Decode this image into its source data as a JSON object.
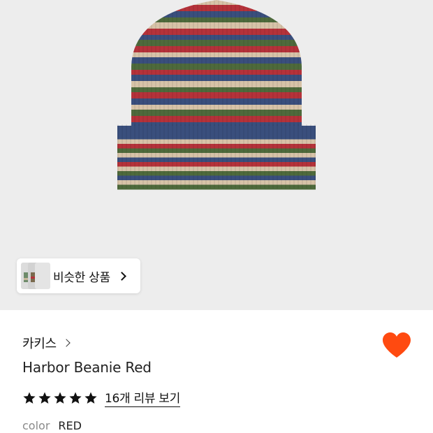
{
  "similar": {
    "label": "비슷한 상품"
  },
  "brand": {
    "name": "카키스"
  },
  "product": {
    "name": "Harbor Beanie Red"
  },
  "rating": {
    "stars": 5,
    "review_link": "16개 리뷰 보기"
  },
  "color": {
    "label": "color",
    "value": "RED"
  },
  "colors": {
    "heart": "#ff4a10",
    "hero_bg": "#ededed",
    "stripe_navy": "#3a4f7d",
    "stripe_red": "#b5323a",
    "stripe_green": "#4e6a3c",
    "stripe_beige": "#d7c3a8"
  },
  "icons": {
    "wishlist": "heart-icon",
    "star": "star-icon",
    "chevron": "chevron-right-icon"
  }
}
